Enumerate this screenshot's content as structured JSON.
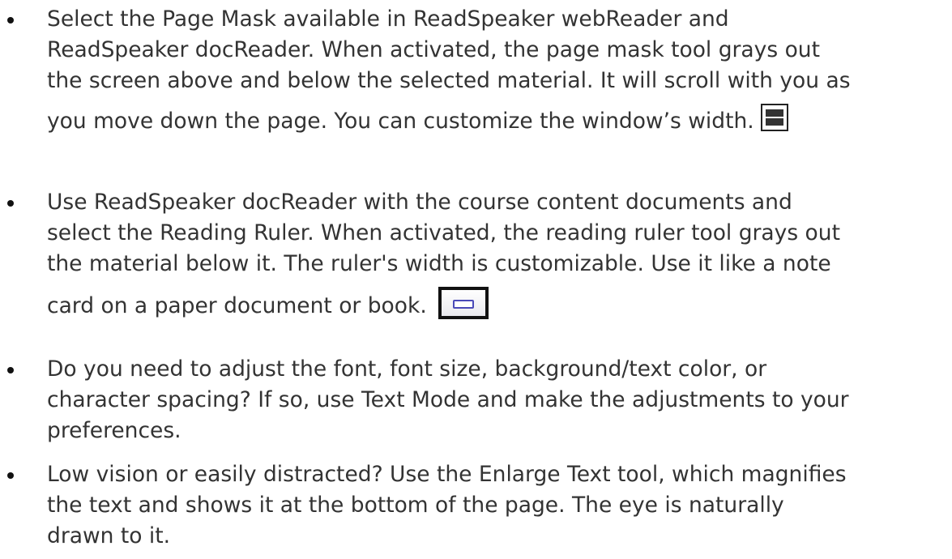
{
  "bullets": [
    {
      "lines": [
        "Select the Page Mask available in ReadSpeaker webReader and",
        "ReadSpeaker docReader. When activated, the page mask tool grays out",
        "the screen above and below the selected material.  It will scroll with you as",
        "you move down the page. You can customize the window’s width."
      ],
      "icon": "page-mask-icon"
    },
    {
      "lines": [
        "Use ReadSpeaker docReader with the course content documents and",
        "select the Reading Ruler. When activated, the reading ruler tool grays out",
        "the material below it. The ruler's width is customizable. Use it like a note",
        "card on a paper document or book."
      ],
      "icon": "reading-ruler-icon"
    },
    {
      "lines": [
        "Do you need to adjust the font, font size, background/text color, or",
        "character spacing? If so, use Text Mode and make the adjustments to your",
        "preferences."
      ]
    },
    {
      "lines": [
        "Low vision or easily distracted?  Use the Enlarge Text tool, which magnifies",
        "the text and shows it at the bottom of the page.  The eye is naturally",
        "drawn to it."
      ]
    }
  ],
  "colors": {
    "text": "#333333",
    "bullet": "#111111",
    "ruler_accent": "#4a4ab8"
  }
}
